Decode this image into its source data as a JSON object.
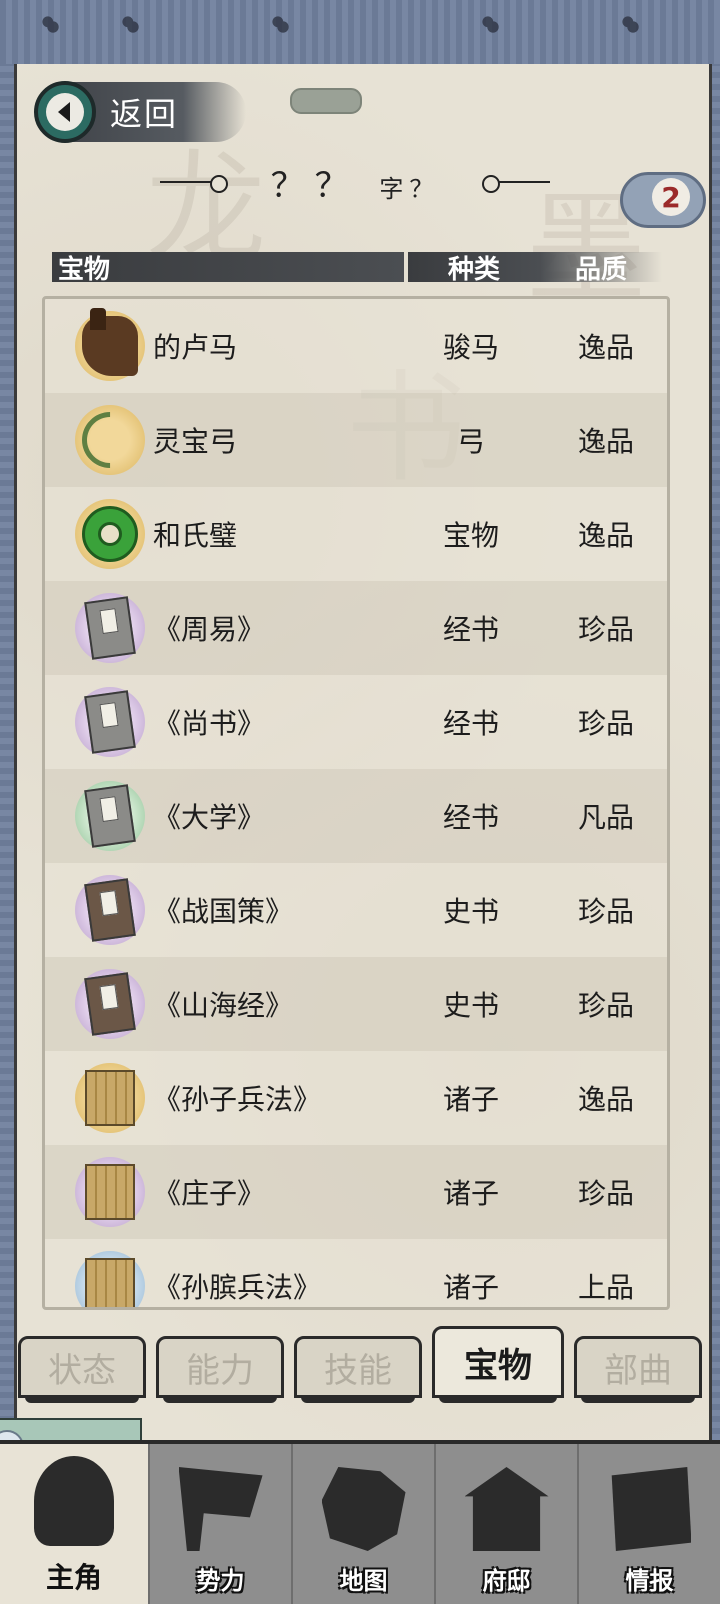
{
  "header": {
    "back_label": "返回",
    "name_main": "？？",
    "name_sub": "字？",
    "badge_number": "2"
  },
  "columns": {
    "name": "宝物",
    "type": "种类",
    "quality": "品质"
  },
  "items": [
    {
      "name": "的卢马",
      "type": "骏马",
      "quality": "逸品",
      "icon": "horse-icon"
    },
    {
      "name": "灵宝弓",
      "type": "弓",
      "quality": "逸品",
      "icon": "bow-icon"
    },
    {
      "name": "和氏璧",
      "type": "宝物",
      "quality": "逸品",
      "icon": "jade-disc-icon"
    },
    {
      "name": "《周易》",
      "type": "经书",
      "quality": "珍品",
      "icon": "book-icon"
    },
    {
      "name": "《尚书》",
      "type": "经书",
      "quality": "珍品",
      "icon": "book-icon"
    },
    {
      "name": "《大学》",
      "type": "经书",
      "quality": "凡品",
      "icon": "book-icon"
    },
    {
      "name": "《战国策》",
      "type": "史书",
      "quality": "珍品",
      "icon": "history-book-icon"
    },
    {
      "name": "《山海经》",
      "type": "史书",
      "quality": "珍品",
      "icon": "history-book-icon"
    },
    {
      "name": "《孙子兵法》",
      "type": "诸子",
      "quality": "逸品",
      "icon": "scrolls-icon"
    },
    {
      "name": "《庄子》",
      "type": "诸子",
      "quality": "珍品",
      "icon": "scrolls-icon"
    },
    {
      "name": "《孙膑兵法》",
      "type": "诸子",
      "quality": "上品",
      "icon": "scrolls-icon"
    }
  ],
  "tabs": [
    {
      "label": "状态",
      "active": false
    },
    {
      "label": "能力",
      "active": false
    },
    {
      "label": "技能",
      "active": false
    },
    {
      "label": "宝物",
      "active": true
    },
    {
      "label": "部曲",
      "active": false
    }
  ],
  "nav": [
    {
      "label": "主角",
      "icon": "hero-icon",
      "active": true
    },
    {
      "label": "势力",
      "icon": "flag-icon",
      "active": false
    },
    {
      "label": "地图",
      "icon": "map-icon",
      "active": false
    },
    {
      "label": "府邸",
      "icon": "mansion-icon",
      "active": false
    },
    {
      "label": "情报",
      "icon": "scroll-icon",
      "active": false
    }
  ],
  "colors": {
    "paper": "#e7e2d5",
    "frame": "#6b7a96",
    "back_button": "#2c6b62",
    "badge_text": "#9b2a2a"
  }
}
